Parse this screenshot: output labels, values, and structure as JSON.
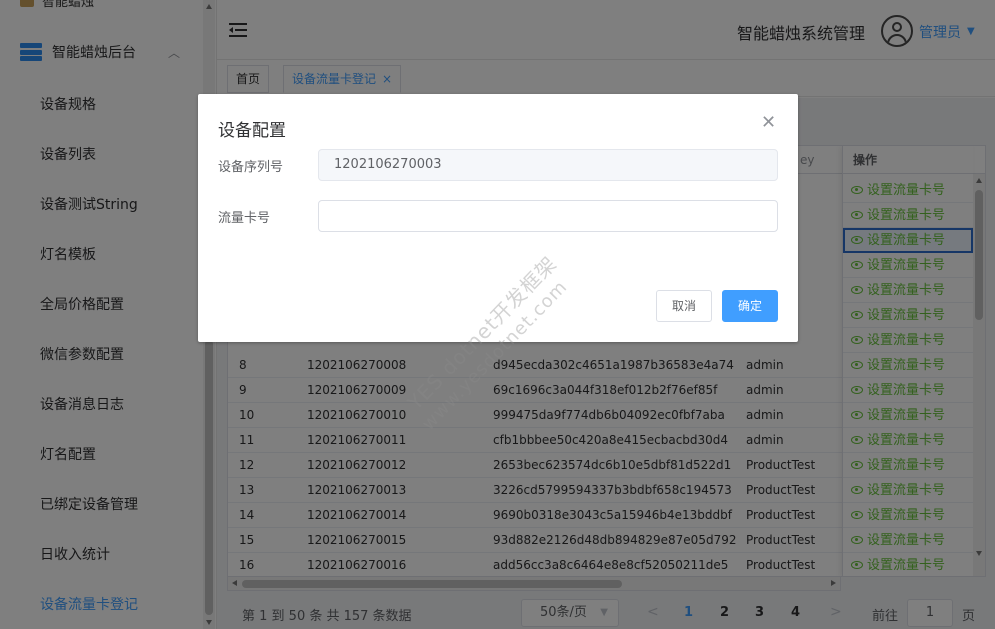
{
  "sidebar": {
    "cut_label": "智能蜡烛",
    "group_label": "智能蜡烛后台",
    "items": [
      "设备规格",
      "设备列表",
      "设备测试String",
      "灯名模板",
      "全局价格配置",
      "微信参数配置",
      "设备消息日志",
      "灯名配置",
      "已绑定设备管理",
      "日收入统计",
      "设备流量卡登记"
    ],
    "active_index": 10
  },
  "header": {
    "system_title": "智能蜡烛系统管理",
    "user_name": "管理员"
  },
  "tabs": [
    {
      "label": "首页"
    },
    {
      "label": "设备流量卡登记"
    }
  ],
  "table": {
    "headers": {
      "key_suffix": "ey",
      "operation": "操作"
    },
    "rows": [
      {
        "index": "8",
        "serial": "1202106270008",
        "key": "d945ecda302c4651a1987b36583e4a74",
        "user": "admin"
      },
      {
        "index": "9",
        "serial": "1202106270009",
        "key": "69c1696c3a044f318ef012b2f76ef85f",
        "user": "admin"
      },
      {
        "index": "10",
        "serial": "1202106270010",
        "key": "999475da9f774db6b04092ec0fbf7aba",
        "user": "admin"
      },
      {
        "index": "11",
        "serial": "1202106270011",
        "key": "cfb1bbbee50c420a8e415ecbacbd30d4",
        "user": "admin"
      },
      {
        "index": "12",
        "serial": "1202106270012",
        "key": "2653bec623574dc6b10e5dbf81d522d1",
        "user": "ProductTest"
      },
      {
        "index": "13",
        "serial": "1202106270013",
        "key": "3226cd5799594337b3bdbf658c194573",
        "user": "ProductTest"
      },
      {
        "index": "14",
        "serial": "1202106270014",
        "key": "9690b0318e3043c5a15946b4e13bddbf",
        "user": "ProductTest"
      },
      {
        "index": "15",
        "serial": "1202106270015",
        "key": "93d882e2126d48db894829e87e05d792",
        "user": "ProductTest"
      },
      {
        "index": "16",
        "serial": "1202106270016",
        "key": "add56cc3a8c6464e8e8cf52050211de5",
        "user": "ProductTest"
      }
    ],
    "action_label": "设置流量卡号",
    "action_count": 16
  },
  "pagination": {
    "total_text": "第 1 到 50 条 共 157 条数据",
    "page_size": "50条/页",
    "pages": [
      "1",
      "2",
      "3",
      "4"
    ],
    "current_page": "1",
    "goto_prefix": "前往",
    "goto_value": "1",
    "goto_suffix": "页"
  },
  "dialog": {
    "title": "设备配置",
    "serial_label": "设备序列号",
    "serial_value": "1202106270003",
    "card_label": "流量卡号",
    "card_value": "",
    "cancel_label": "取消",
    "confirm_label": "确定"
  },
  "watermark": {
    "line1": "YES dotnet开发框架",
    "line2": "www.yesdotnet.com"
  },
  "colors": {
    "primary": "#409eff",
    "success": "#67c23a"
  },
  "icons": {
    "menu": "hamburger-icon",
    "close": "close-icon",
    "view": "eye-icon"
  }
}
